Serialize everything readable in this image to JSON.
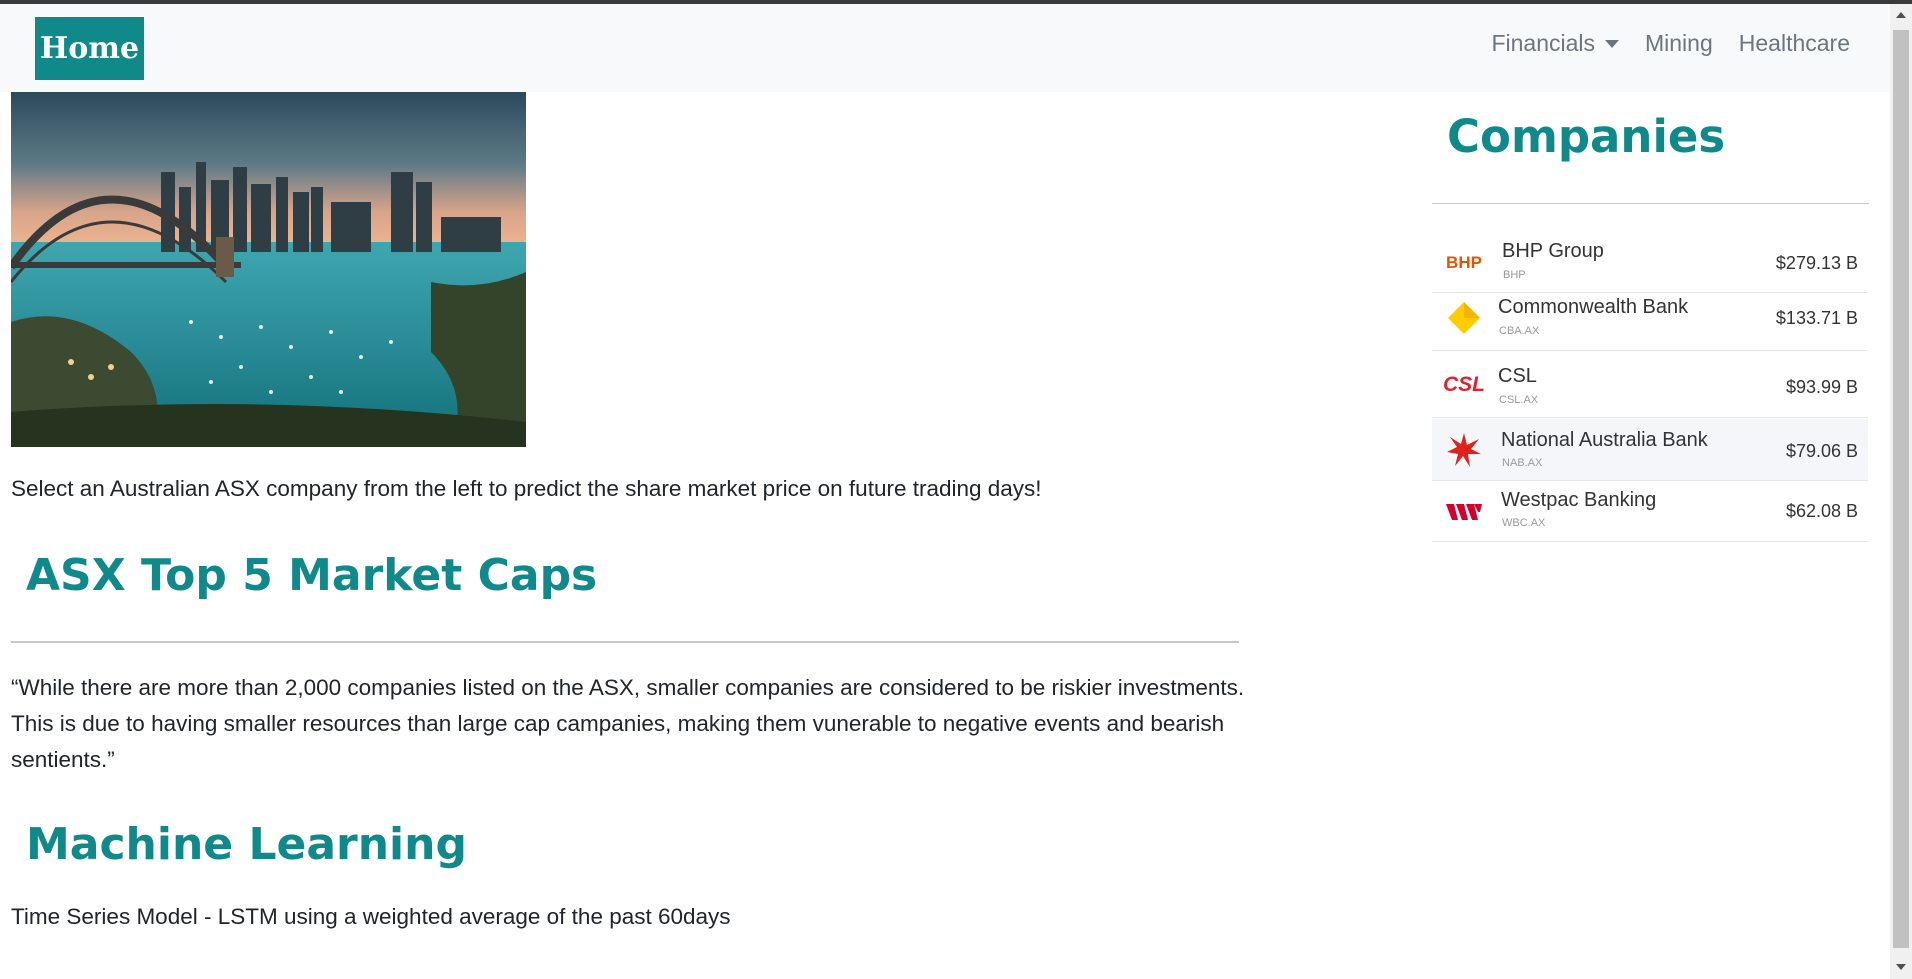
{
  "nav": {
    "brand": "Home",
    "links": [
      "Financials",
      "Mining",
      "Healthcare"
    ]
  },
  "hero": {
    "image": "sydney-harbour-bridge-photo"
  },
  "intro": "Select an Australian ASX company from the left to predict the share market price on future trading days!",
  "section_asx": {
    "title": "ASX Top 5 Market Caps",
    "quote": "“While there are more than 2,000 companies listed on the ASX, smaller companies are considered to be riskier investments. This is due to having smaller resources than large cap campanies, making them vunerable to negative events and bearish sentients.”"
  },
  "section_ml": {
    "title": "Machine Learning",
    "text": "Time Series Model - LSTM using a weighted average of the past 60days"
  },
  "sidebar": {
    "title": "Companies",
    "companies": [
      {
        "name": "BHP Group",
        "ticker": "BHP",
        "cap": "$279.13 B",
        "logo": "BHP"
      },
      {
        "name": "Commonwealth Bank",
        "ticker": "CBA.AX",
        "cap": "$133.71 B",
        "logo": "cba-diamond-icon"
      },
      {
        "name": "CSL",
        "ticker": "CSL.AX",
        "cap": "$93.99 B",
        "logo": "CSL"
      },
      {
        "name": "National Australia Bank",
        "ticker": "NAB.AX",
        "cap": "$79.06 B",
        "logo": "nab-star-icon"
      },
      {
        "name": "Westpac Banking",
        "ticker": "WBC.AX",
        "cap": "$62.08 B",
        "logo": "westpac-w-icon"
      }
    ]
  },
  "colors": {
    "accent": "#10898a",
    "bhp": "#e65400",
    "cba": "#ffcc00",
    "csl": "#e4202e",
    "nab": "#e0201b",
    "westpac": "#d5002b"
  }
}
